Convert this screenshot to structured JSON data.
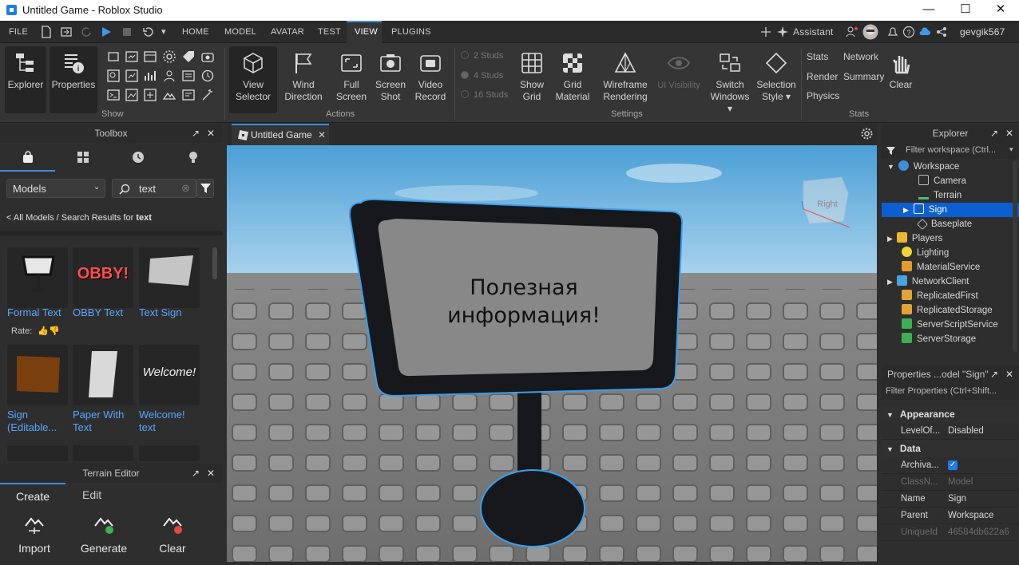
{
  "window": {
    "title": "Untitled Game - Roblox Studio"
  },
  "menubar": {
    "file": "FILE",
    "tabs": [
      "HOME",
      "MODEL",
      "AVATAR",
      "TEST",
      "VIEW",
      "PLUGINS"
    ],
    "active_tab": "VIEW",
    "assistant": "Assistant",
    "username": "gevgik567"
  },
  "ribbon": {
    "show": {
      "label": "Show",
      "explorer": "Explorer",
      "properties": "Properties"
    },
    "actions": {
      "label": "Actions",
      "view_selector": [
        "View",
        "Selector"
      ],
      "wind_direction": [
        "Wind",
        "Direction"
      ],
      "full_screen": [
        "Full",
        "Screen"
      ],
      "screen_shot": [
        "Screen",
        "Shot"
      ],
      "video_record": [
        "Video",
        "Record"
      ]
    },
    "settings": {
      "label": "Settings",
      "studs": [
        "2 Studs",
        "4 Studs",
        "16 Studs"
      ],
      "show_grid": [
        "Show",
        "Grid"
      ],
      "grid_material": [
        "Grid",
        "Material"
      ],
      "wireframe": [
        "Wireframe",
        "Rendering"
      ],
      "ui_visibility": "UI Visibility",
      "switch_windows": [
        "Switch",
        "Windows ▾"
      ],
      "selection_style": [
        "Selection",
        "Style ▾"
      ]
    },
    "stats": {
      "label": "Stats",
      "items": [
        "Stats",
        "Network",
        "Render",
        "Summary",
        "Physics"
      ],
      "clear": "Clear"
    }
  },
  "toolbox": {
    "title": "Toolbox",
    "category": "Models",
    "search": "text",
    "breadcrumb_prefix": "< All Models / Search Results for ",
    "breadcrumb_query": "text",
    "rate_label": "Rate:",
    "items": [
      {
        "label": [
          "Formal Text",
          ""
        ]
      },
      {
        "label": [
          "OBBY Text",
          ""
        ]
      },
      {
        "label": [
          "Text Sign",
          ""
        ]
      },
      {
        "label": [
          "Sign",
          "(Editable..."
        ]
      },
      {
        "label": [
          "Paper With",
          "Text"
        ]
      },
      {
        "label": [
          "Welcome!",
          "text"
        ]
      }
    ],
    "obby_art": "OBBY!",
    "welcome_art": "Welcome!"
  },
  "terrain_editor": {
    "title": "Terrain Editor",
    "tabs": [
      "Create",
      "Edit"
    ],
    "tools": [
      "Import",
      "Generate",
      "Clear"
    ]
  },
  "document": {
    "tab": "Untitled Game",
    "sign_text": [
      "Полезная",
      "информация!"
    ],
    "view_cube": "Right"
  },
  "explorer": {
    "title": "Explorer",
    "filter": "Filter workspace (Ctrl...",
    "items": [
      {
        "name": "Workspace",
        "color": "#3e8fdc"
      },
      {
        "name": "Camera",
        "color": "#bdbdbd"
      },
      {
        "name": "Terrain",
        "color": "#4bbf6b"
      },
      {
        "name": "Sign",
        "color": "#d8d8d8"
      },
      {
        "name": "Baseplate",
        "color": "#bdbdbd"
      },
      {
        "name": "Players",
        "color": "#e8b931"
      },
      {
        "name": "Lighting",
        "color": "#f2d33b"
      },
      {
        "name": "MaterialService",
        "color": "#e39b2f"
      },
      {
        "name": "NetworkClient",
        "color": "#4aa3e0"
      },
      {
        "name": "ReplicatedFirst",
        "color": "#e0a33a"
      },
      {
        "name": "ReplicatedStorage",
        "color": "#e0a33a"
      },
      {
        "name": "ServerScriptService",
        "color": "#3fae55"
      },
      {
        "name": "ServerStorage",
        "color": "#3fae55"
      }
    ]
  },
  "properties": {
    "title": "Properties ...odel \"Sign\"",
    "filter": "Filter Properties (Ctrl+Shift...",
    "sections": {
      "appearance": "Appearance",
      "data": "Data"
    },
    "rows": [
      {
        "name": "LevelOf...",
        "value": "Disabled"
      },
      {
        "name": "Archiva...",
        "value": ""
      },
      {
        "name": "ClassN...",
        "value": "Model"
      },
      {
        "name": "Name",
        "value": "Sign"
      },
      {
        "name": "Parent",
        "value": "Workspace"
      },
      {
        "name": "UniqueId",
        "value": "46584db622a6"
      }
    ]
  },
  "colors": {
    "accent": "#3c8ce6",
    "selection": "#0b5fd1",
    "link": "#5aa6ff"
  }
}
